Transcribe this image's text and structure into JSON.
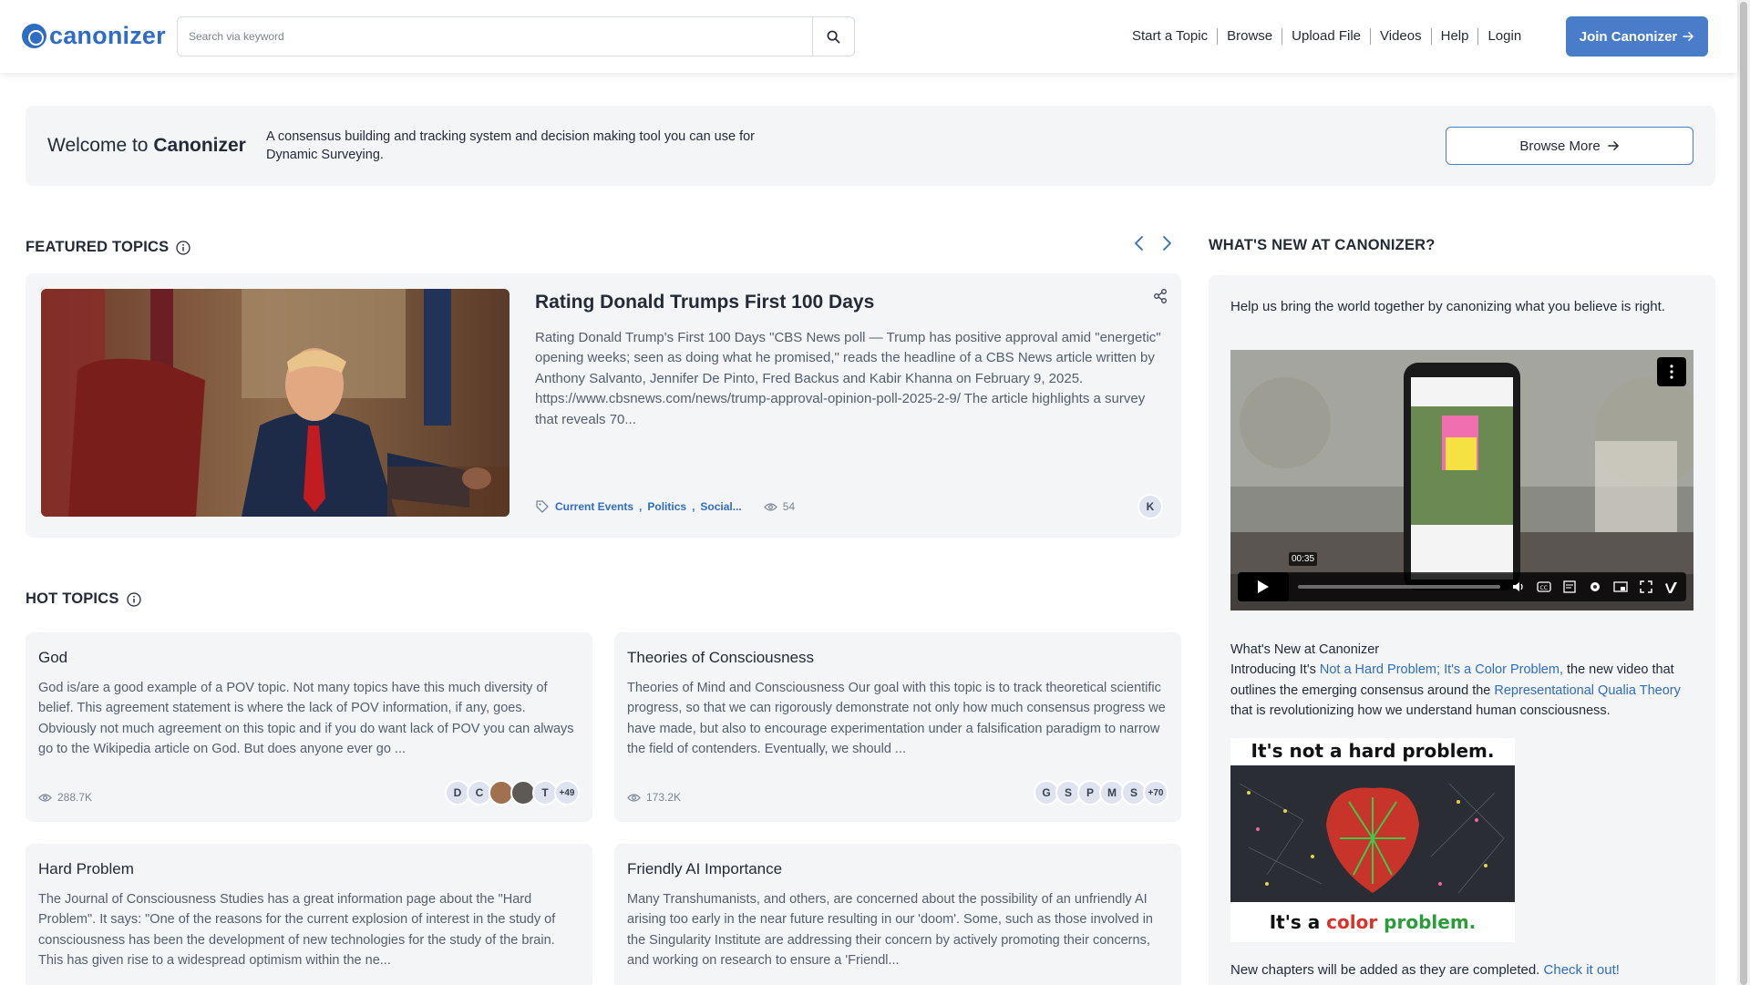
{
  "header": {
    "logo_text": "canonizer",
    "search_placeholder": "Search via keyword",
    "nav": [
      "Start a Topic",
      "Browse",
      "Upload File",
      "Videos",
      "Help",
      "Login"
    ],
    "join_label": "Join Canonizer"
  },
  "welcome": {
    "title_prefix": "Welcome to",
    "title_brand": "Canonizer",
    "description": "A consensus building and tracking system and decision making tool you can use for Dynamic Surveying.",
    "browse_more": "Browse More"
  },
  "featured": {
    "section_title": "FEATURED TOPICS",
    "title": "Rating Donald Trumps First 100 Days",
    "description": "Rating Donald Trump's First 100 Days \"CBS News poll — Trump has positive approval amid \"energetic\" opening weeks; seen as doing what he promised,\" reads the headline of a CBS News article written by Anthony Salvanto, Jennifer De Pinto, Fred Backus and Kabir Khanna on February 9, 2025. https://www.cbsnews.com/news/trump-approval-opinion-poll-2025-2-9/ The article highlights a survey that reveals 70...",
    "tags": [
      "Current Events",
      "Politics",
      "Social..."
    ],
    "views": "54",
    "avatar": "K"
  },
  "hot": {
    "section_title": "HOT TOPICS",
    "cards": [
      {
        "title": "God",
        "description": "God is/are a good example of a POV topic. Not many topics have this much diversity of belief. This agreement statement is where the lack of POV information, if any, goes. Obviously not much agreement on this topic and if you do want lack of POV you can always go to the Wikipedia article on God. But does anyone ever go ...",
        "views": "288.7K",
        "avatars": [
          "D",
          "C",
          "",
          "",
          "T"
        ],
        "more": "+49"
      },
      {
        "title": "Theories of Consciousness",
        "description": "Theories of Mind and Consciousness Our goal with this topic is to track theoretical scientific progress, so that we can rigorously demonstrate not only how much consensus progress we have made, but also to encourage experimentation under a falsification paradigm to narrow the field of contenders. Eventually, we should ...",
        "views": "173.2K",
        "avatars": [
          "G",
          "S",
          "P",
          "M",
          "S"
        ],
        "more": "+70"
      },
      {
        "title": "Hard Problem",
        "description": "The Journal of Consciousness Studies has a great information page about the \"Hard Problem\". It says: \"One of the reasons for the current explosion of interest in the study of consciousness has been the development of new technologies for the study of the brain. This has given rise to a widespread optimism within the ne..."
      },
      {
        "title": "Friendly AI Importance",
        "description": "Many Transhumanists, and others, are concerned about the possibility of an unfriendly AI arising too early in the near future resulting in our 'doom'. Some, such as those involved in the Singularity Institute are addressing their concern by actively promoting their concerns, and working on research to ensure a 'Friendl..."
      }
    ]
  },
  "news": {
    "section_title": "WHAT'S NEW AT CANONIZER?",
    "intro": "Help us bring the world together by canonizing what you believe is right.",
    "video_time": "00:35",
    "heading": "What's New at Canonizer",
    "intro_prefix": "Introducing It's ",
    "link1": "Not a Hard Problem; It's a Color Problem,",
    "middle": " the new video that outlines the emerging consensus around the ",
    "link2": "Representational Qualia Theory",
    "suffix": " that is revolutionizing how we understand human consciousness.",
    "image_top": "It's not a hard problem.",
    "image_bottom_prefix": "It's a ",
    "image_bottom_color": "color",
    "image_bottom_word": " problem.",
    "foot_text": "New chapters will be added as they are completed. ",
    "foot_link": "Check it out!"
  },
  "colors": {
    "brand": "#2f6cc4",
    "join_button": "#4a7dc9",
    "card_bg": "#f4f5f7"
  }
}
